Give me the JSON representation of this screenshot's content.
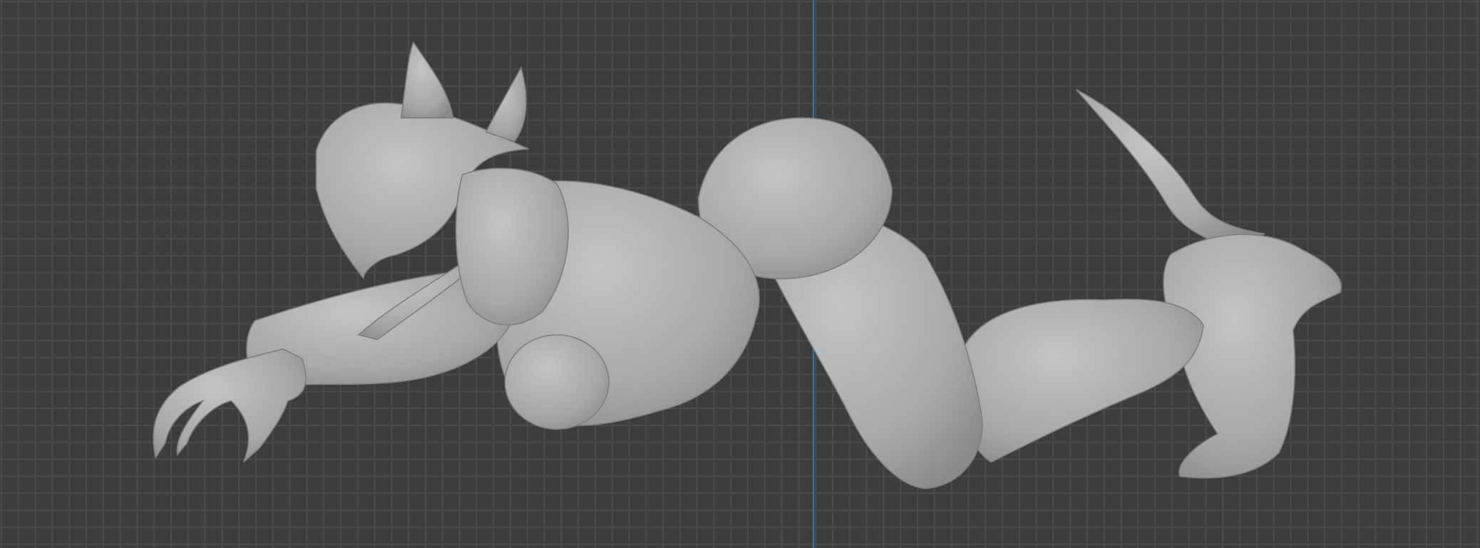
{
  "viewport": {
    "type": "3d-viewport-orthographic",
    "colors": {
      "background": "#3d3d3d",
      "grid": "#4b4b4b",
      "z_axis": "#3f6fa6",
      "mesh": "#a9a9a9"
    },
    "object": "sculpted-creature-mesh"
  }
}
